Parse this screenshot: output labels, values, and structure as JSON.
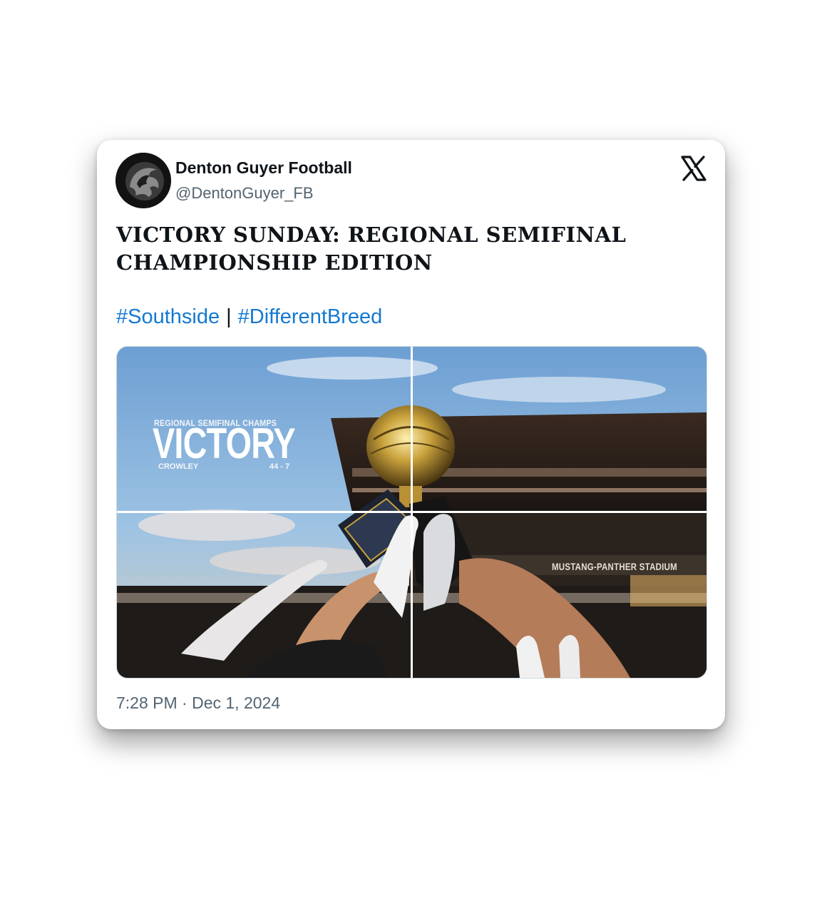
{
  "tweet": {
    "display_name": "Denton Guyer Football",
    "handle": "@DentonGuyer_FB",
    "headline": "VICTORY SUNDAY: REGIONAL SEMIFINAL CHAMPIONSHIP EDITION",
    "hashtags": [
      "#Southside",
      "#DifferentBreed"
    ],
    "hashtag_separator": "|",
    "timestamp": "7:28 PM · Dec 1, 2024"
  },
  "media": {
    "overlay_subtitle": "REGIONAL SEMIFINAL CHAMPS",
    "overlay_title": "VICTORY",
    "overlay_opponent": "CROWLEY",
    "overlay_score": "44 - 7",
    "stadium_sign": "MUSTANG-PANTHER STADIUM"
  },
  "icons": {
    "brand_logo": "x-logo-icon",
    "avatar": "panther-logo-icon"
  },
  "colors": {
    "hashtag": "#1479d1",
    "text": "#0f1419",
    "muted": "#536471"
  }
}
